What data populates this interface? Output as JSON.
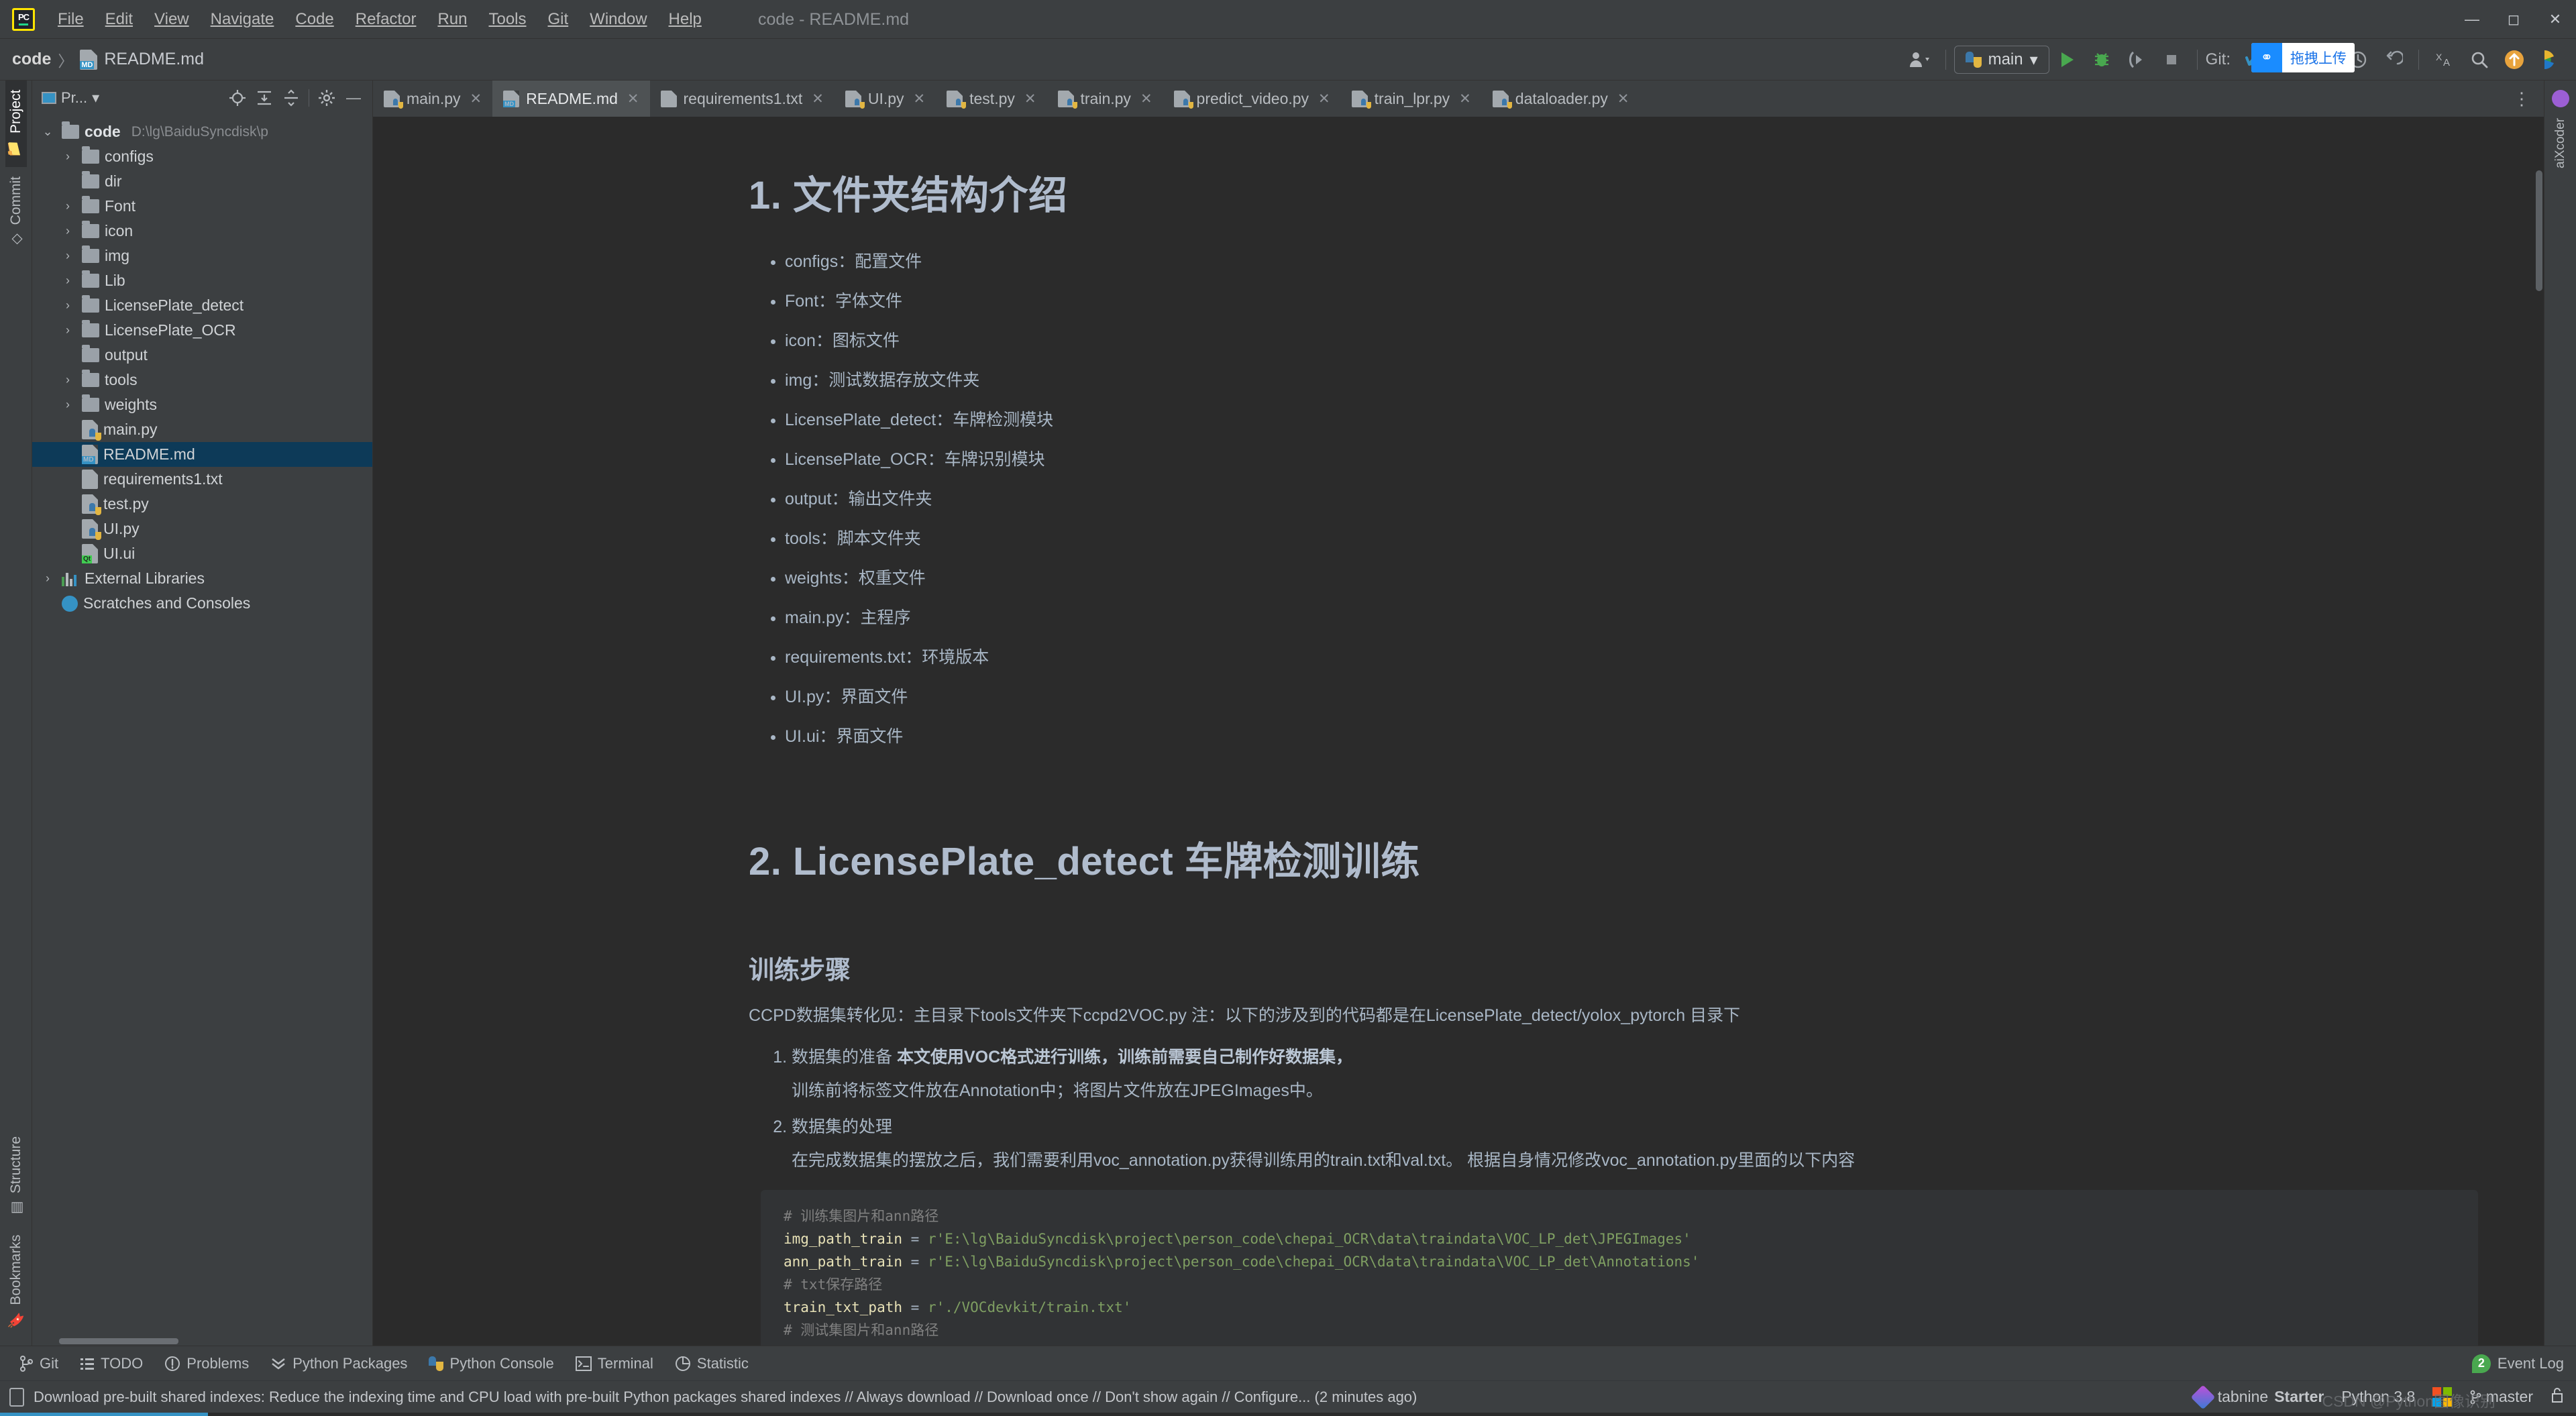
{
  "window": {
    "title": "code - README.md",
    "app_logo": "pycharm-logo",
    "controls": [
      "minimize",
      "maximize",
      "close"
    ]
  },
  "menubar": {
    "items": [
      "File",
      "Edit",
      "View",
      "Navigate",
      "Code",
      "Refactor",
      "Run",
      "Tools",
      "Git",
      "Window",
      "Help"
    ]
  },
  "navbar": {
    "project": "code",
    "separator": "〉",
    "file": "README.md",
    "file_badge": "MD"
  },
  "toolbar": {
    "profile_icon": "user-dropdown-icon",
    "run_config": "main",
    "run": "run-icon",
    "debug": "debug-icon",
    "coverage": "coverage-icon",
    "stop": "stop-icon",
    "git_label": "Git:",
    "update": "update-project-icon",
    "commit": "commit-icon",
    "push": "push-icon",
    "history": "history-icon",
    "rollback": "rollback-icon",
    "search_everywhere": "search-icon",
    "translate": "translate-icon",
    "upload_chip_label": "拖拽上传",
    "upload_chip_icon": "baidu-cloud-icon",
    "orange_up": "upload-icon",
    "rainbow": "ai-icon"
  },
  "left_strip": {
    "top": [
      {
        "label": "Project",
        "icon": "folder-icon",
        "active": true
      },
      {
        "label": "Commit",
        "icon": "commit-icon",
        "active": false
      }
    ],
    "bottom": [
      {
        "label": "Structure",
        "icon": "structure-icon"
      },
      {
        "label": "Bookmarks",
        "icon": "bookmark-icon"
      }
    ]
  },
  "right_strip": {
    "items": [
      {
        "label": "aiXcoder",
        "icon": "aixcoder-icon"
      }
    ]
  },
  "project_panel": {
    "title": "Pr...",
    "title_dropdown": "▾",
    "icons": [
      "locate-icon",
      "expand-all-icon",
      "collapse-all-icon",
      "settings-gear-icon",
      "hide-icon"
    ],
    "tree": [
      {
        "label": "code",
        "path": "D:\\lg\\BaiduSyncdisk\\p",
        "type": "root-folder",
        "arrow": "⌄",
        "depth": 0,
        "selected": false
      },
      {
        "label": "configs",
        "type": "folder",
        "arrow": "›",
        "depth": 1,
        "selected": false
      },
      {
        "label": "dir",
        "type": "folder",
        "arrow": "",
        "depth": 1,
        "selected": false
      },
      {
        "label": "Font",
        "type": "folder",
        "arrow": "›",
        "depth": 1,
        "selected": false
      },
      {
        "label": "icon",
        "type": "folder",
        "arrow": "›",
        "depth": 1,
        "selected": false
      },
      {
        "label": "img",
        "type": "folder",
        "arrow": "›",
        "depth": 1,
        "selected": false
      },
      {
        "label": "Lib",
        "type": "folder",
        "arrow": "›",
        "depth": 1,
        "selected": false
      },
      {
        "label": "LicensePlate_detect",
        "type": "folder",
        "arrow": "›",
        "depth": 1,
        "selected": false
      },
      {
        "label": "LicensePlate_OCR",
        "type": "folder",
        "arrow": "›",
        "depth": 1,
        "selected": false
      },
      {
        "label": "output",
        "type": "folder",
        "arrow": "",
        "depth": 1,
        "selected": false
      },
      {
        "label": "tools",
        "type": "folder",
        "arrow": "›",
        "depth": 1,
        "selected": false
      },
      {
        "label": "weights",
        "type": "folder",
        "arrow": "›",
        "depth": 1,
        "selected": false
      },
      {
        "label": "main.py",
        "type": "python",
        "arrow": "",
        "depth": 1,
        "selected": false
      },
      {
        "label": "README.md",
        "type": "markdown",
        "arrow": "",
        "depth": 1,
        "selected": true
      },
      {
        "label": "requirements1.txt",
        "type": "text",
        "arrow": "",
        "depth": 1,
        "selected": false
      },
      {
        "label": "test.py",
        "type": "python",
        "arrow": "",
        "depth": 1,
        "selected": false
      },
      {
        "label": "UI.py",
        "type": "python",
        "arrow": "",
        "depth": 1,
        "selected": false
      },
      {
        "label": "UI.ui",
        "type": "qt",
        "arrow": "",
        "depth": 1,
        "selected": false
      },
      {
        "label": "External Libraries",
        "type": "library",
        "arrow": "›",
        "depth": 0,
        "selected": false
      },
      {
        "label": "Scratches and Consoles",
        "type": "scratches",
        "arrow": "",
        "depth": 0,
        "selected": false
      }
    ]
  },
  "editor_tabs": [
    {
      "label": "main.py",
      "type": "python",
      "active": false
    },
    {
      "label": "README.md",
      "type": "markdown",
      "active": true
    },
    {
      "label": "requirements1.txt",
      "type": "text",
      "active": false
    },
    {
      "label": "UI.py",
      "type": "python",
      "active": false
    },
    {
      "label": "test.py",
      "type": "python",
      "active": false
    },
    {
      "label": "train.py",
      "type": "python",
      "active": false
    },
    {
      "label": "predict_video.py",
      "type": "python",
      "active": false
    },
    {
      "label": "train_lpr.py",
      "type": "python",
      "active": false
    },
    {
      "label": "dataloader.py",
      "type": "python",
      "active": false
    }
  ],
  "preview": {
    "h1_section1": "1. 文件夹结构介绍",
    "structure_items": [
      "configs：配置文件",
      "Font：字体文件",
      "icon：图标文件",
      "img：测试数据存放文件夹",
      "LicensePlate_detect：车牌检测模块",
      "LicensePlate_OCR：车牌识别模块",
      "output：输出文件夹",
      "tools：脚本文件夹",
      "weights：权重文件",
      "main.py：主程序",
      "requirements.txt：环境版本",
      "UI.py：界面文件",
      "UI.ui：界面文件"
    ],
    "h1_section2": "2. LicensePlate_detect 车牌检测训练",
    "h2_steps": "训练步骤",
    "ccpd_paragraph": "CCPD数据集转化见：主目录下tools文件夹下ccpd2VOC.py 注：以下的涉及到的代码都是在LicensePlate_detect/yolox_pytorch 目录下",
    "ol_item1_prefix": "数据集的准备 ",
    "ol_item1_bold": "本文使用VOC格式进行训练，训练前需要自己制作好数据集，",
    "ol_item1_sub": "训练前将标签文件放在Annotation中；将图片文件放在JPEGImages中。",
    "ol_item2": "数据集的处理",
    "ol_item2_sub": "在完成数据集的摆放之后，我们需要利用voc_annotation.py获得训练用的train.txt和val.txt。 根据自身情况修改voc_annotation.py里面的以下内容",
    "code_lines": [
      {
        "comment": "# 训练集图片和ann路径"
      },
      {
        "var": "img_path_train",
        "op": " = ",
        "str": "r'E:\\lg\\BaiduSyncdisk\\project\\person_code\\chepai_OCR\\data\\traindata\\VOC_LP_det\\JPEGImages'"
      },
      {
        "var": "ann_path_train",
        "op": " = ",
        "str": "r'E:\\lg\\BaiduSyncdisk\\project\\person_code\\chepai_OCR\\data\\traindata\\VOC_LP_det\\Annotations'"
      },
      {
        "comment": "# txt保存路径"
      },
      {
        "var": "train_txt_path",
        "op": " = ",
        "str": "r'./VOCdevkit/train.txt'"
      },
      {
        "comment": "# 测试集图片和ann路径"
      }
    ]
  },
  "bottom_bar": {
    "items": [
      {
        "label": "Git",
        "icon": "git-branch-icon"
      },
      {
        "label": "TODO",
        "icon": "todo-list-icon"
      },
      {
        "label": "Problems",
        "icon": "problems-icon"
      },
      {
        "label": "Python Packages",
        "icon": "python-packages-icon"
      },
      {
        "label": "Python Console",
        "icon": "python-console-icon"
      },
      {
        "label": "Terminal",
        "icon": "terminal-icon"
      },
      {
        "label": "Statistic",
        "icon": "statistic-icon"
      }
    ],
    "event_log_count": "2",
    "event_log_label": "Event Log"
  },
  "notification": {
    "icon": "index-notification-icon",
    "text": "Download pre-built shared indexes: Reduce the indexing time and CPU load with pre-built Python packages shared indexes // Always download // Download once // Don't show again // Configure... (2 minutes ago)"
  },
  "status_bar": {
    "tabnine": "tabnine",
    "tabnine_plan": "Starter",
    "interpreter": "Python 3.8",
    "branch": "master",
    "lock_icon": "unlocked-icon",
    "watermark": "CSDN @Python图像识别"
  },
  "colors": {
    "accent_blue": "#3592c4",
    "selection_blue": "#0d3a58",
    "editor_bg": "#2b2b2b",
    "chrome_bg": "#3c3f41",
    "text": "#a9b7c6",
    "green": "#49a84f",
    "string_green": "#7f9f62"
  }
}
